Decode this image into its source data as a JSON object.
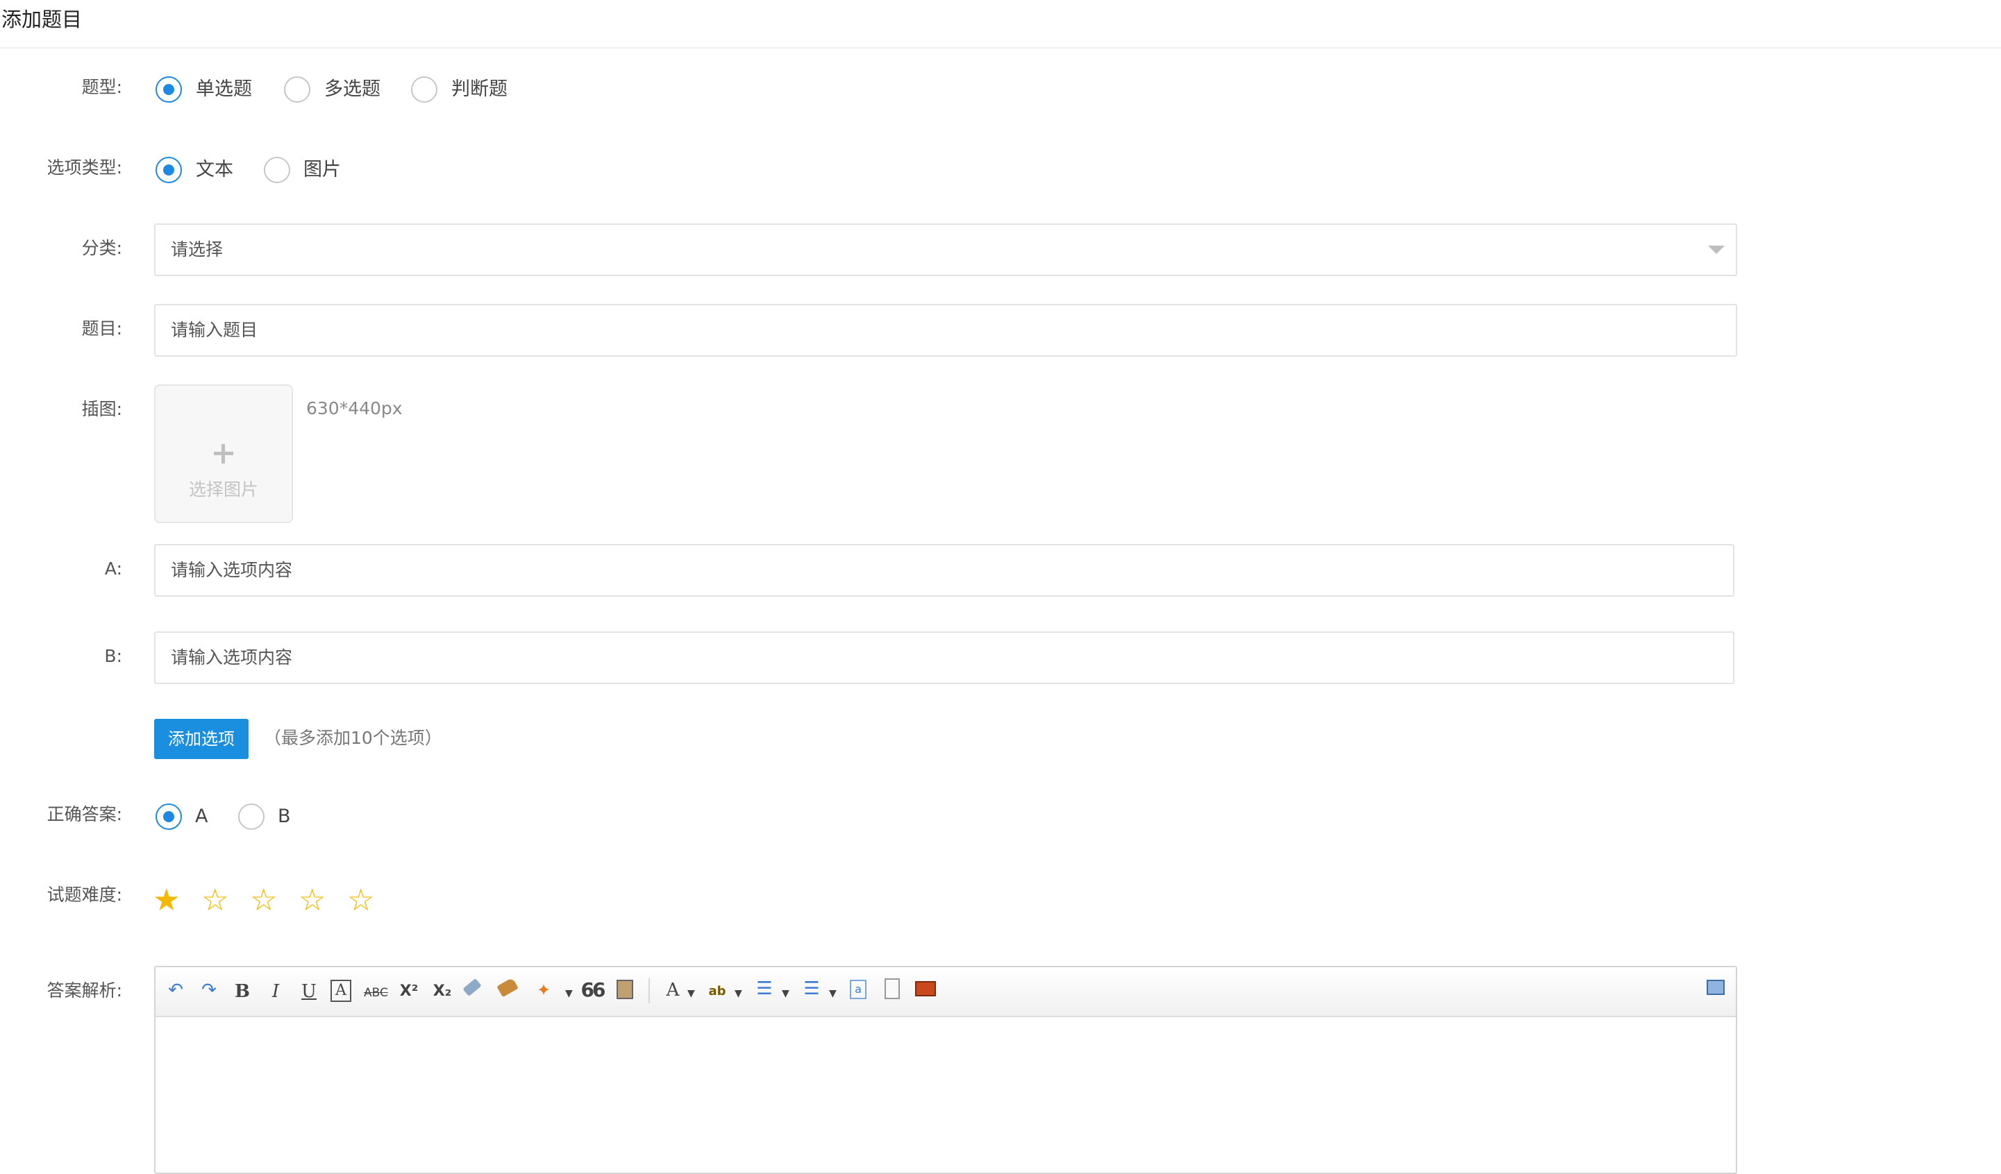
{
  "page": {
    "title": "添加题目"
  },
  "form": {
    "question_type": {
      "label": "题型:",
      "options": [
        "单选题",
        "多选题",
        "判断题"
      ],
      "selected": "单选题"
    },
    "option_type": {
      "label": "选项类型:",
      "options": [
        "文本",
        "图片"
      ],
      "selected": "文本"
    },
    "category": {
      "label": "分类:",
      "value": "请选择"
    },
    "question": {
      "label": "题目:",
      "placeholder": "请输入题目"
    },
    "illustration": {
      "label": "插图:",
      "button_text": "选择图片",
      "size_hint": "630*440px"
    },
    "options": [
      {
        "label": "A:",
        "placeholder": "请输入选项内容"
      },
      {
        "label": "B:",
        "placeholder": "请输入选项内容"
      }
    ],
    "add_option": {
      "label": "添加选项",
      "hint": "（最多添加10个选项）"
    },
    "correct_answer": {
      "label": "正确答案:",
      "options": [
        "A",
        "B"
      ],
      "selected": "A"
    },
    "difficulty": {
      "label": "试题难度:",
      "rating": 1,
      "max": 5
    },
    "analysis": {
      "label": "答案解析:",
      "toolbar_icons": [
        "undo-icon",
        "redo-icon",
        "bold-icon",
        "italic-icon",
        "underline-icon",
        "font-border-icon",
        "strikethrough-icon",
        "superscript-icon",
        "subscript-icon",
        "eraser-icon",
        "format-brush-icon",
        "auto-format-icon",
        "blockquote-icon",
        "paste-plain-icon",
        "font-color-icon",
        "background-color-icon",
        "ordered-list-icon",
        "unordered-list-icon",
        "select-all-icon",
        "clear-doc-icon",
        "insert-image-icon",
        "preview-icon"
      ],
      "toolbar_glyphs": {
        "bold": "B",
        "italic": "I",
        "underline": "U",
        "font_border": "A",
        "strike": "ABC",
        "sup": "X²",
        "sub": "X₂",
        "quote": "66",
        "font_color": "A"
      }
    }
  },
  "colors": {
    "primary": "#1a8fe0",
    "star": "#f5b800",
    "radio_on": "#1e88e5"
  }
}
